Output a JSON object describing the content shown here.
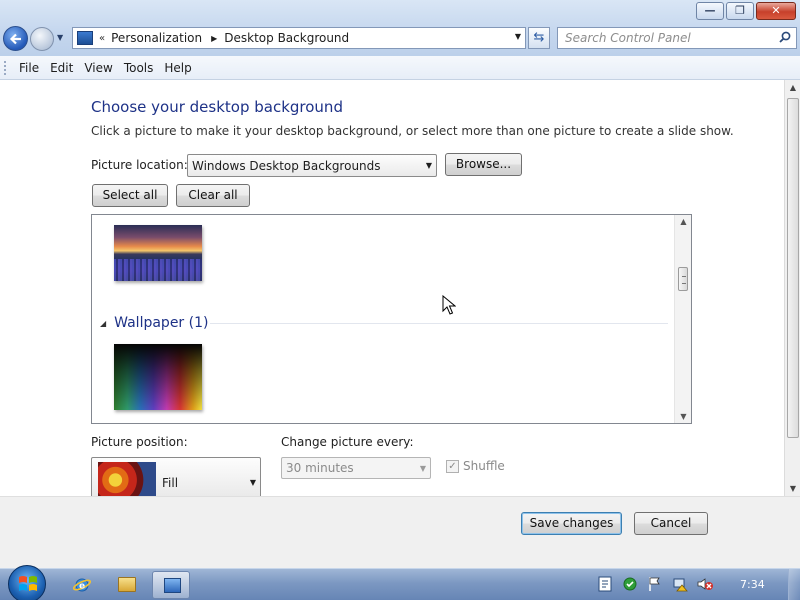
{
  "window": {
    "minimize_glyph": "—",
    "maximize_glyph": "❐",
    "close_glyph": "✕"
  },
  "address_bar": {
    "breadcrumb": [
      "Personalization",
      "Desktop Background"
    ],
    "icon": "control-panel-icon"
  },
  "search": {
    "placeholder": "Search Control Panel"
  },
  "menu": [
    "File",
    "Edit",
    "View",
    "Tools",
    "Help"
  ],
  "content": {
    "heading": "Choose your desktop background",
    "description": "Click a picture to make it your desktop background, or select more than one picture to create a slide show.",
    "picture_location_label": "Picture location:",
    "picture_location_value": "Windows Desktop Backgrounds",
    "browse_label": "Browse...",
    "select_all_label": "Select all",
    "clear_all_label": "Clear all",
    "group_title": "Wallpaper (1)",
    "picture_position_label": "Picture position:",
    "picture_position_value": "Fill",
    "change_picture_label": "Change picture every:",
    "change_picture_value": "30 minutes",
    "shuffle_label": "Shuffle",
    "shuffle_checked": true
  },
  "footer": {
    "save_label": "Save changes",
    "cancel_label": "Cancel"
  },
  "taskbar": {
    "apps": [
      "internet-explorer",
      "windows-explorer",
      "control-panel"
    ],
    "tray_icons": [
      "action-center",
      "security",
      "flag",
      "network",
      "volume-muted"
    ],
    "clock": "7:34"
  },
  "colors": {
    "heading": "#1e3287",
    "accent_button_border": "#3c7fb1"
  }
}
